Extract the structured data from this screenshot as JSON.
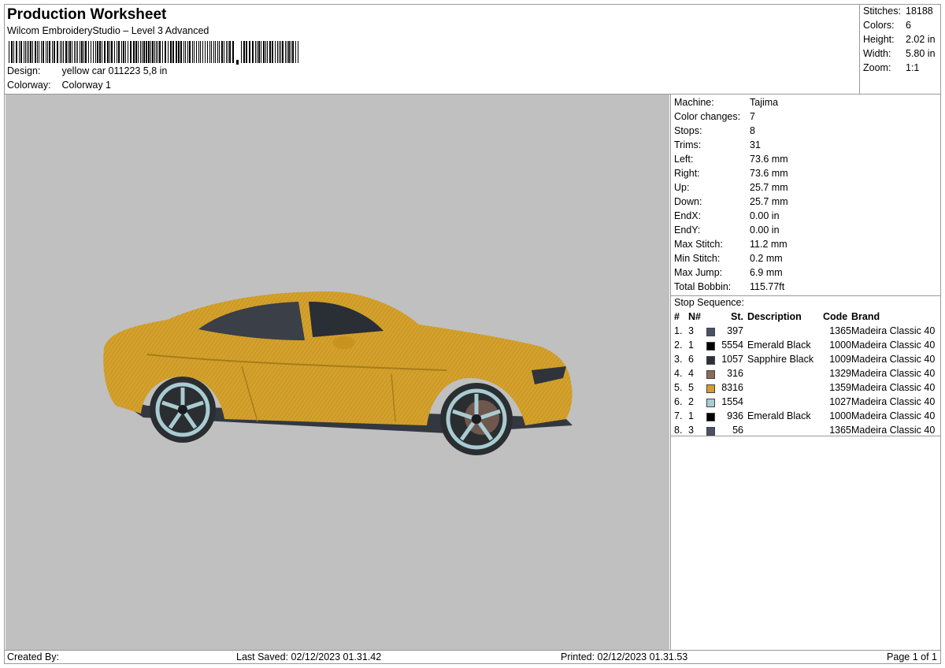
{
  "header": {
    "title": "Production Worksheet",
    "subtitle": "Wilcom EmbroideryStudio – Level 3 Advanced",
    "design_label": "Design:",
    "design_value": "yellow car 011223 5,8 in",
    "colorway_label": "Colorway:",
    "colorway_value": "Colorway 1"
  },
  "summary": [
    {
      "label": "Stitches:",
      "value": "18188"
    },
    {
      "label": "Colors:",
      "value": "6"
    },
    {
      "label": "Height:",
      "value": "2.02 in"
    },
    {
      "label": "Width:",
      "value": "5.80 in"
    },
    {
      "label": "Zoom:",
      "value": "1:1"
    }
  ],
  "machine_info": [
    {
      "label": "Machine:",
      "value": "Tajima"
    },
    {
      "label": "Color changes:",
      "value": "7"
    },
    {
      "label": "Stops:",
      "value": "8"
    },
    {
      "label": "Trims:",
      "value": "31"
    },
    {
      "label": "Left:",
      "value": "73.6 mm"
    },
    {
      "label": "Right:",
      "value": "73.6 mm"
    },
    {
      "label": "Up:",
      "value": "25.7 mm"
    },
    {
      "label": "Down:",
      "value": "25.7 mm"
    },
    {
      "label": "EndX:",
      "value": "0.00 in"
    },
    {
      "label": "EndY:",
      "value": "0.00 in"
    },
    {
      "label": "Max Stitch:",
      "value": "11.2 mm"
    },
    {
      "label": "Min Stitch:",
      "value": "0.2 mm"
    },
    {
      "label": "Max Jump:",
      "value": "6.9 mm"
    },
    {
      "label": "Total Bobbin:",
      "value": "115.77ft"
    }
  ],
  "stop_sequence": {
    "title": "Stop Sequence:",
    "headers": {
      "hash": "#",
      "n": "N#",
      "st": "St.",
      "description": "Description",
      "code": "Code",
      "brand": "Brand"
    },
    "rows": [
      {
        "num": "1.",
        "n": "3",
        "color": "#4a5068",
        "st": "397",
        "description": "",
        "code": "1365",
        "brand": "Madeira Classic 40"
      },
      {
        "num": "2.",
        "n": "1",
        "color": "#000000",
        "st": "5554",
        "description": "Emerald Black",
        "code": "1000",
        "brand": "Madeira Classic 40"
      },
      {
        "num": "3.",
        "n": "6",
        "color": "#2e3038",
        "st": "1057",
        "description": "Sapphire Black",
        "code": "1009",
        "brand": "Madeira Classic 40"
      },
      {
        "num": "4.",
        "n": "4",
        "color": "#8b6a5c",
        "st": "316",
        "description": "",
        "code": "1329",
        "brand": "Madeira Classic 40"
      },
      {
        "num": "5.",
        "n": "5",
        "color": "#d49e2a",
        "st": "8316",
        "description": "",
        "code": "1359",
        "brand": "Madeira Classic 40"
      },
      {
        "num": "6.",
        "n": "2",
        "color": "#a9cbd2",
        "st": "1554",
        "description": "",
        "code": "1027",
        "brand": "Madeira Classic 40"
      },
      {
        "num": "7.",
        "n": "1",
        "color": "#000000",
        "st": "936",
        "description": "Emerald Black",
        "code": "1000",
        "brand": "Madeira Classic 40"
      },
      {
        "num": "8.",
        "n": "3",
        "color": "#4a5068",
        "st": "56",
        "description": "",
        "code": "1365",
        "brand": "Madeira Classic 40"
      }
    ]
  },
  "footer": {
    "created_by": "Created By:",
    "last_saved": "Last Saved: 02/12/2023 01.31.42",
    "printed": "Printed: 02/12/2023 01.31.53",
    "page": "Page 1 of 1"
  },
  "colors": {
    "preview_bg": "#c0c0c0",
    "car_body": "#d4a12c",
    "rim": "#a9cbd2"
  }
}
